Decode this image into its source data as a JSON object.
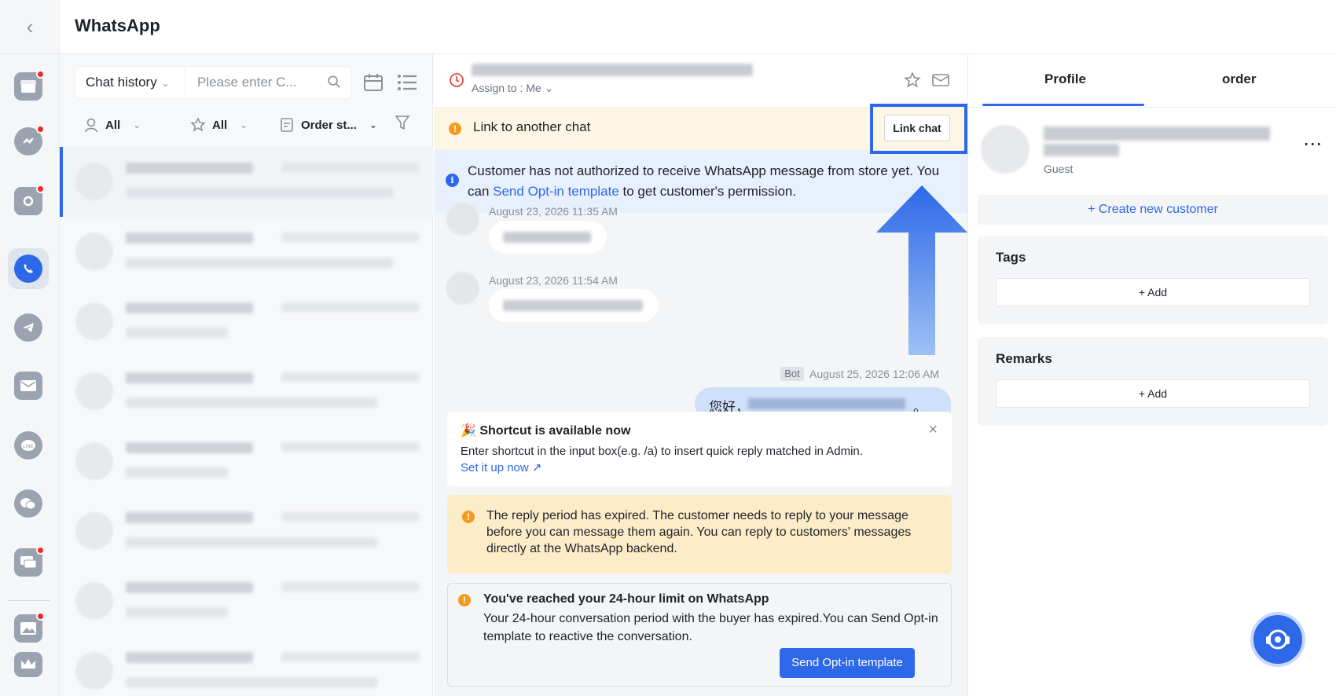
{
  "app": {
    "title": "WhatsApp"
  },
  "rail": {
    "items": [
      {
        "icon": "store-icon",
        "badge": true
      },
      {
        "icon": "messenger-icon",
        "badge": true
      },
      {
        "icon": "instagram-icon",
        "badge": true
      },
      {
        "icon": "whatsapp-icon",
        "badge": false,
        "active": true
      },
      {
        "icon": "telegram-icon",
        "badge": false
      },
      {
        "icon": "email-icon",
        "badge": false
      },
      {
        "icon": "line-icon",
        "badge": false
      },
      {
        "icon": "wechat-icon",
        "badge": false
      },
      {
        "icon": "chat-bubbles-icon",
        "badge": true
      },
      {
        "icon": "image-icon",
        "badge": true
      },
      {
        "icon": "crown-icon",
        "badge": false
      }
    ]
  },
  "chat_list": {
    "history_select": "Chat history",
    "search_placeholder": "Please enter C...",
    "filters": {
      "assignee": "All",
      "star": "All",
      "order_status": "Order st..."
    }
  },
  "chat": {
    "assign_label": "Assign to : Me",
    "link_bar": {
      "text": "Link to another chat",
      "button": "Link chat"
    },
    "auth_notice": {
      "before": "Customer has not authorized to receive WhatsApp message from store yet. You can ",
      "link": "Send Opt-in template",
      "after": " to get customer's permission."
    },
    "messages": [
      {
        "time": "August 23, 2026 11:35 AM"
      },
      {
        "time": "August 23, 2026 11:54 AM"
      }
    ],
    "outgoing": {
      "tag": "Bot",
      "time": "August 25, 2026 12:06 AM",
      "text_start": "您好，",
      "text_end": "。"
    },
    "shortcut": {
      "title": "Shortcut is available now",
      "desc": "Enter shortcut in the input box(e.g. /a) to insert quick reply matched in Admin.",
      "link": "Set it up now"
    },
    "expired": {
      "text": "The reply period has expired. The customer needs to reply to your message before you can message them again. You can reply to customers' messages directly at the WhatsApp backend."
    },
    "limit": {
      "title": "You've reached your 24-hour limit on WhatsApp",
      "desc": "Your 24-hour conversation period with the buyer has expired.You can Send Opt-in template to reactive the conversation.",
      "button": "Send Opt-in template"
    }
  },
  "profile": {
    "tabs": [
      "Profile",
      "order"
    ],
    "role": "Guest",
    "create_customer": "+ Create new customer",
    "tags": {
      "title": "Tags",
      "add": "+ Add"
    },
    "remarks": {
      "title": "Remarks",
      "add": "+ Add"
    }
  },
  "colors": {
    "accent": "#2d68e8",
    "warning": "#f39b1c",
    "badge": "#ee2b2b"
  }
}
